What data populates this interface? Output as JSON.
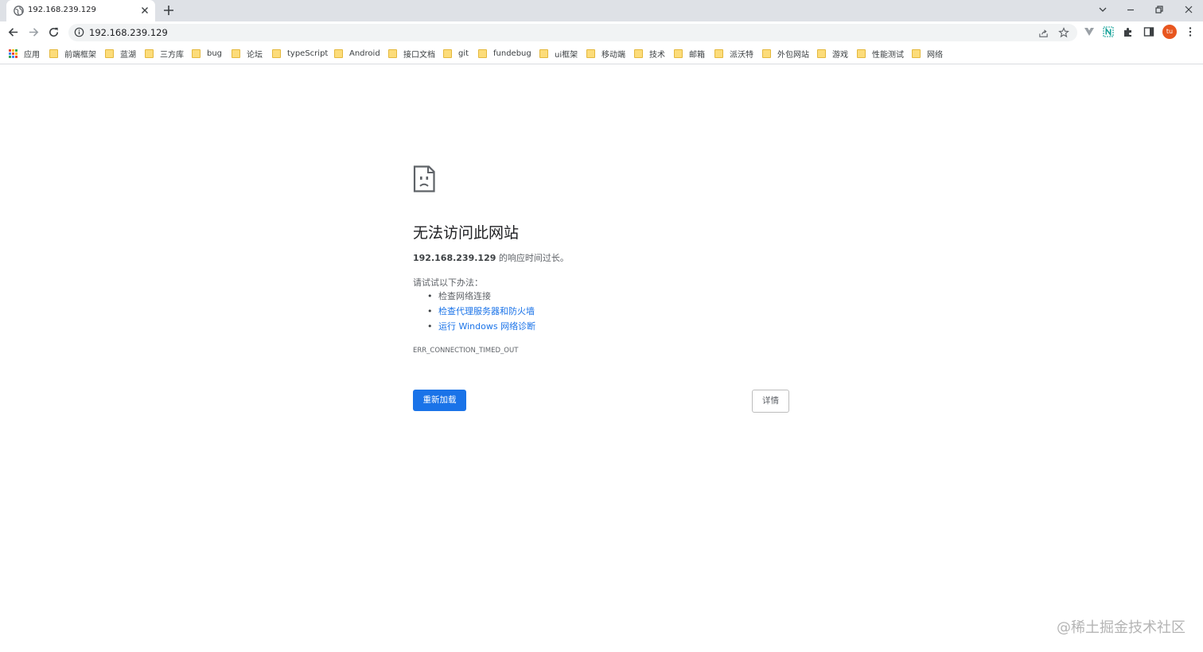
{
  "browser": {
    "tab": {
      "title": "192.168.239.129"
    },
    "address_bar": {
      "url": "192.168.239.129"
    },
    "avatar": {
      "initials": "tu",
      "color": "#e8561f"
    },
    "accent": "#1a73e8"
  },
  "bookmarks": {
    "apps_label": "应用",
    "items": [
      {
        "label": "前端框架"
      },
      {
        "label": "蓝湖"
      },
      {
        "label": "三方库"
      },
      {
        "label": "bug"
      },
      {
        "label": "论坛"
      },
      {
        "label": "typeScript"
      },
      {
        "label": "Android"
      },
      {
        "label": "接口文档"
      },
      {
        "label": "git"
      },
      {
        "label": "fundebug"
      },
      {
        "label": "ui框架"
      },
      {
        "label": "移动端"
      },
      {
        "label": "技术"
      },
      {
        "label": "邮箱"
      },
      {
        "label": "派沃特"
      },
      {
        "label": "外包网站"
      },
      {
        "label": "游戏"
      },
      {
        "label": "性能测试"
      },
      {
        "label": "网络"
      }
    ]
  },
  "error": {
    "title": "无法访问此网站",
    "host": "192.168.239.129",
    "desc_suffix": " 的响应时间过长。",
    "try_label": "请试试以下办法：",
    "suggestions": [
      {
        "text": "检查网络连接"
      },
      {
        "text": "检查代理服务器和防火墙"
      },
      {
        "text": "运行 Windows 网络诊断"
      }
    ],
    "code": "ERR_CONNECTION_TIMED_OUT",
    "reload_label": "重新加载",
    "details_label": "详情"
  },
  "watermark": "@稀土掘金技术社区"
}
